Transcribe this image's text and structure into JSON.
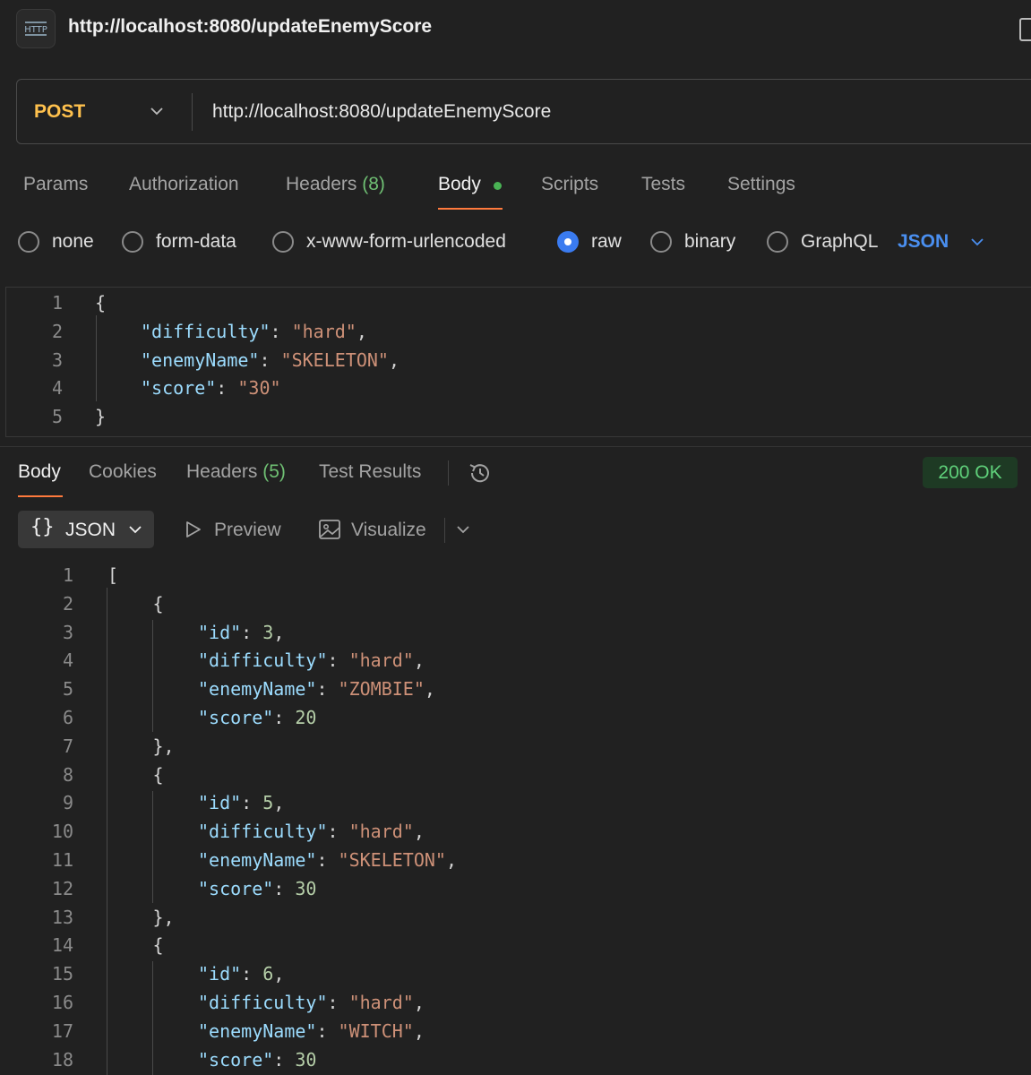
{
  "request": {
    "title": "http://localhost:8080/updateEnemyScore",
    "method": "POST",
    "url": "http://localhost:8080/updateEnemyScore",
    "tabs": [
      {
        "label": "Params",
        "count": ""
      },
      {
        "label": "Authorization",
        "count": ""
      },
      {
        "label": "Headers",
        "count": "(8)"
      },
      {
        "label": "Body",
        "count": ""
      },
      {
        "label": "Scripts",
        "count": ""
      },
      {
        "label": "Tests",
        "count": ""
      },
      {
        "label": "Settings",
        "count": ""
      }
    ],
    "body_types": [
      "none",
      "form-data",
      "x-www-form-urlencoded",
      "raw",
      "binary",
      "GraphQL"
    ],
    "selected_body_type": "raw",
    "format": "JSON",
    "body_lines": [
      [
        [
          "p",
          "{"
        ]
      ],
      [
        [
          "k",
          "\"difficulty\""
        ],
        [
          "p",
          ": "
        ],
        [
          "s",
          "\"hard\""
        ],
        [
          "p",
          ","
        ]
      ],
      [
        [
          "k",
          "\"enemyName\""
        ],
        [
          "p",
          ": "
        ],
        [
          "s",
          "\"SKELETON\""
        ],
        [
          "p",
          ","
        ]
      ],
      [
        [
          "k",
          "\"score\""
        ],
        [
          "p",
          ": "
        ],
        [
          "s",
          "\"30\""
        ]
      ],
      [
        [
          "p",
          "}"
        ]
      ]
    ]
  },
  "response": {
    "tabs": [
      {
        "label": "Body",
        "count": ""
      },
      {
        "label": "Cookies",
        "count": ""
      },
      {
        "label": "Headers",
        "count": "(5)"
      },
      {
        "label": "Test Results",
        "count": ""
      }
    ],
    "status": "200 OK",
    "view_format": "JSON",
    "preview_label": "Preview",
    "visualize_label": "Visualize",
    "body_lines": [
      [
        0,
        [
          [
            "p",
            "["
          ]
        ]
      ],
      [
        1,
        [
          [
            "p",
            "{"
          ]
        ]
      ],
      [
        2,
        [
          [
            "k",
            "\"id\""
          ],
          [
            "p",
            ": "
          ],
          [
            "n",
            "3"
          ],
          [
            "p",
            ","
          ]
        ]
      ],
      [
        2,
        [
          [
            "k",
            "\"difficulty\""
          ],
          [
            "p",
            ": "
          ],
          [
            "s",
            "\"hard\""
          ],
          [
            "p",
            ","
          ]
        ]
      ],
      [
        2,
        [
          [
            "k",
            "\"enemyName\""
          ],
          [
            "p",
            ": "
          ],
          [
            "s",
            "\"ZOMBIE\""
          ],
          [
            "p",
            ","
          ]
        ]
      ],
      [
        2,
        [
          [
            "k",
            "\"score\""
          ],
          [
            "p",
            ": "
          ],
          [
            "n",
            "20"
          ]
        ]
      ],
      [
        1,
        [
          [
            "p",
            "},"
          ]
        ]
      ],
      [
        1,
        [
          [
            "p",
            "{"
          ]
        ]
      ],
      [
        2,
        [
          [
            "k",
            "\"id\""
          ],
          [
            "p",
            ": "
          ],
          [
            "n",
            "5"
          ],
          [
            "p",
            ","
          ]
        ]
      ],
      [
        2,
        [
          [
            "k",
            "\"difficulty\""
          ],
          [
            "p",
            ": "
          ],
          [
            "s",
            "\"hard\""
          ],
          [
            "p",
            ","
          ]
        ]
      ],
      [
        2,
        [
          [
            "k",
            "\"enemyName\""
          ],
          [
            "p",
            ": "
          ],
          [
            "s",
            "\"SKELETON\""
          ],
          [
            "p",
            ","
          ]
        ]
      ],
      [
        2,
        [
          [
            "k",
            "\"score\""
          ],
          [
            "p",
            ": "
          ],
          [
            "n",
            "30"
          ]
        ]
      ],
      [
        1,
        [
          [
            "p",
            "},"
          ]
        ]
      ],
      [
        1,
        [
          [
            "p",
            "{"
          ]
        ]
      ],
      [
        2,
        [
          [
            "k",
            "\"id\""
          ],
          [
            "p",
            ": "
          ],
          [
            "n",
            "6"
          ],
          [
            "p",
            ","
          ]
        ]
      ],
      [
        2,
        [
          [
            "k",
            "\"difficulty\""
          ],
          [
            "p",
            ": "
          ],
          [
            "s",
            "\"hard\""
          ],
          [
            "p",
            ","
          ]
        ]
      ],
      [
        2,
        [
          [
            "k",
            "\"enemyName\""
          ],
          [
            "p",
            ": "
          ],
          [
            "s",
            "\"WITCH\""
          ],
          [
            "p",
            ","
          ]
        ]
      ],
      [
        2,
        [
          [
            "k",
            "\"score\""
          ],
          [
            "p",
            ": "
          ],
          [
            "n",
            "30"
          ]
        ]
      ]
    ]
  },
  "colors": {
    "method": "#ffc14d",
    "accent_underline": "#ff7a3d",
    "json_key": "#9cdcfe",
    "json_string": "#ce9178",
    "json_number": "#b5cea8",
    "status_ok": "#5fd07a",
    "selected_radio": "#3a7bf0"
  },
  "icons": [
    "http-icon",
    "chevron-down-icon",
    "history-icon",
    "braces-icon",
    "play-icon",
    "image-icon",
    "sidebar-toggle-icon"
  ]
}
